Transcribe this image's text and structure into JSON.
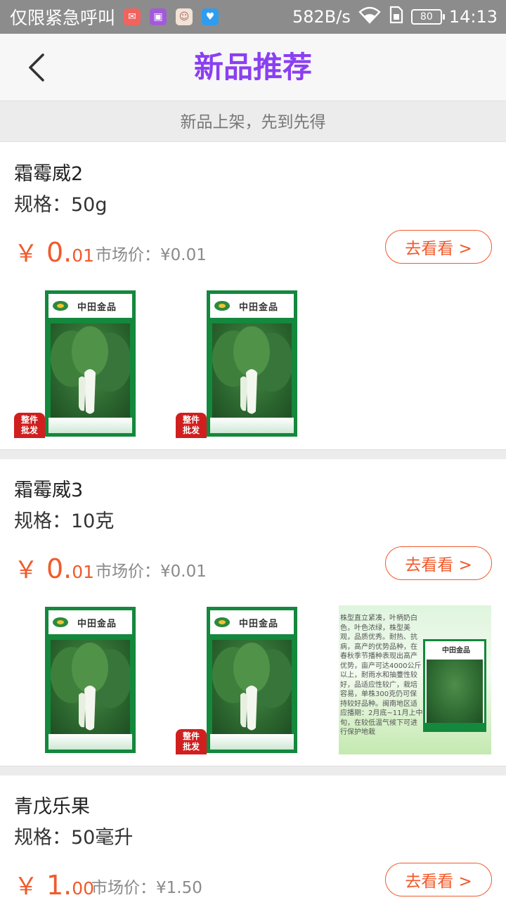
{
  "status_bar": {
    "carrier": "仅限紧急呼叫",
    "app_icons": [
      "mail-icon",
      "gallery-icon",
      "face-icon",
      "heart-app-icon"
    ],
    "net_speed": "582B/s",
    "battery": "80",
    "time": "14:13"
  },
  "header": {
    "title": "新品推荐",
    "back_icon": "chevron-left-icon"
  },
  "subtitle": "新品上架，先到先得",
  "products": [
    {
      "name": "霜霉威2",
      "spec": "规格：50g",
      "price_currency": "￥",
      "price_int": "0.",
      "price_dec": "01",
      "market_price": "市场价：¥0.01",
      "button": "去看看 >",
      "images": [
        {
          "type": "seed-packet",
          "brand": "中田金品",
          "badge": "整件\n批发"
        },
        {
          "type": "seed-packet",
          "brand": "中田金品",
          "badge": "整件\n批发"
        }
      ]
    },
    {
      "name": "霜霉威3",
      "spec": "规格：10克",
      "price_currency": "￥",
      "price_int": "0.",
      "price_dec": "01",
      "market_price": "市场价：¥0.01",
      "button": "去看看 >",
      "images": [
        {
          "type": "seed-packet",
          "brand": "中田金品",
          "badge": ""
        },
        {
          "type": "seed-packet",
          "brand": "中田金品",
          "badge": "整件\n批发"
        },
        {
          "type": "info",
          "brand": "中田金品",
          "text": "株型直立紧凑，叶柄奶白色，叶色浓绿，株型美观，品质优秀。耐热、抗病，高产的优势品种，在春秋季节播种表现出高产优势，亩产可达4000公斤以上，耐雨水和抽薹性较好，品适应性较广，栽培容易，单株300克仍可保持较好品种。闽南地区适应播期：2月底~11月上中旬，在较低温气候下可进行保护地栽"
        }
      ]
    },
    {
      "name": "青戊乐果",
      "spec": "规格：50毫升",
      "price_currency": "￥",
      "price_int": "1.",
      "price_dec": "00",
      "market_price": "市场价：¥1.50",
      "button": "去看看 >",
      "images": []
    }
  ],
  "colors": {
    "title_purple": "#8a3ff2",
    "price_orange": "#f15a2b",
    "packet_green": "#14883d"
  }
}
